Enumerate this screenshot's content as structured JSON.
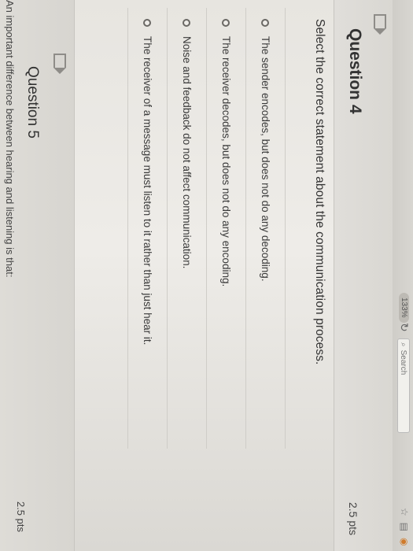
{
  "browser": {
    "zoom": "133%",
    "search_placeholder": "Search"
  },
  "question4": {
    "title": "Question 4",
    "points": "2.5 pts",
    "prompt": "Select the correct statement about the communication process.",
    "answers": [
      "The sender encodes, but does not do any decoding.",
      "The receiver decodes, but does not do any encoding.",
      "Noise and feedback do not affect communication.",
      "The receiver of a message must listen to it rather than just hear it."
    ]
  },
  "question5": {
    "title": "Question 5",
    "points": "2.5 pts",
    "prompt": "An important difference between hearing and listening is that:"
  }
}
